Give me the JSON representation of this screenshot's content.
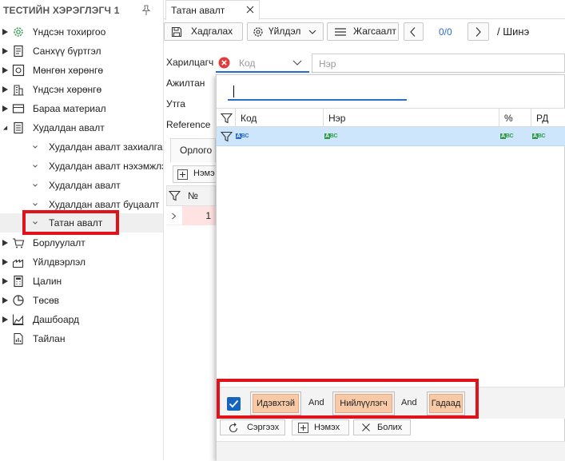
{
  "sidebar": {
    "title": "ТЕСТИЙН ХЭРЭГЛЭГЧ 1",
    "items": [
      {
        "label": "Үндсэн тохиргоо",
        "icon": "gear-icon"
      },
      {
        "label": "Санхүү бүртгэл",
        "icon": "ledger-icon"
      },
      {
        "label": "Мөнгөн хөрөнгө",
        "icon": "cash-icon"
      },
      {
        "label": "Үндсэн хөрөнгө",
        "icon": "building-icon"
      },
      {
        "label": "Бараа материал",
        "icon": "box-icon"
      },
      {
        "label": "Худалдан авалт",
        "icon": "receipt-icon"
      }
    ],
    "subitems": [
      {
        "label": "Худалдан авалт захиалга"
      },
      {
        "label": "Худалдан авалт нэхэмжлэ"
      },
      {
        "label": "Худалдан авалт"
      },
      {
        "label": "Худалдан авалт буцаалт"
      },
      {
        "label": "Татан авалт"
      }
    ],
    "items_after": [
      {
        "label": "Борлуулалт",
        "icon": "cart-icon"
      },
      {
        "label": "Үйлдвэрлэл",
        "icon": "factory-icon"
      },
      {
        "label": "Цалин",
        "icon": "calculator-icon"
      },
      {
        "label": "Төсөв",
        "icon": "pie-icon"
      },
      {
        "label": "Дашбоард",
        "icon": "area-chart-icon"
      },
      {
        "label": "Тайлан",
        "icon": "report-icon"
      }
    ]
  },
  "tabs": [
    {
      "label": "Татан авалт"
    }
  ],
  "toolbar": {
    "search_label": "Хадгалах",
    "actions_label": "Үйлдэл",
    "list_label": "Жагсаалт",
    "pager": "0/0",
    "mode": "/ Шинэ"
  },
  "form": {
    "labels": [
      "Харилцагч",
      "Ажилтан",
      "Утга",
      "Reference"
    ],
    "kod_placeholder": "Код",
    "ner_placeholder": "Нэр",
    "sub_tab": "Орлого",
    "add_label": "Нэмэ",
    "grid_header_no": "№",
    "grid_row_no": "1"
  },
  "popup": {
    "search_value": "",
    "columns": [
      "Код",
      "Нэр",
      "%",
      "РД"
    ],
    "filter": {
      "chips": [
        "Идэвхтэй",
        "Нийлүүлэгч",
        "Гадаад"
      ],
      "joiner": "And",
      "checked": true
    },
    "buttons": {
      "refresh": "Сэргээх",
      "add": "Нэмэх",
      "cancel": "Болих"
    }
  },
  "colors": {
    "accent": "#2b6cd1",
    "highlight": "#e2121a",
    "chip": "#f8c9a6",
    "selected_row": "#cde6fb"
  }
}
